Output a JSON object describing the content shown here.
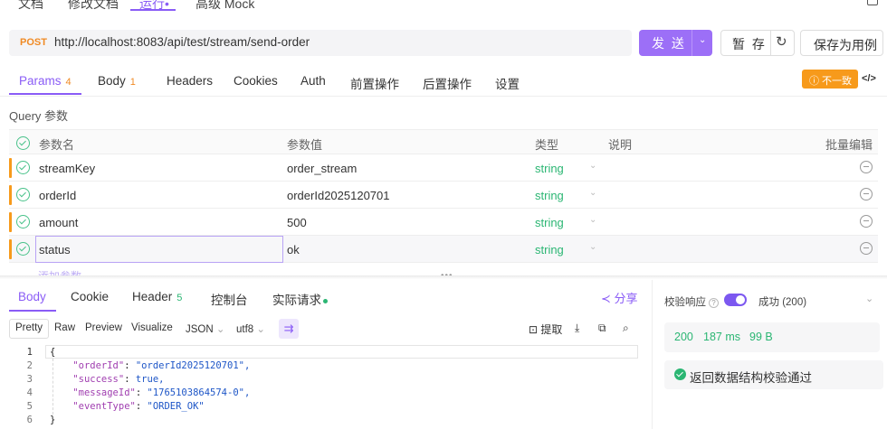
{
  "top_tabs": [
    {
      "label": "文档"
    },
    {
      "label": "修改文档"
    },
    {
      "label": "运行•"
    },
    {
      "label": "高级 Mock"
    }
  ],
  "request": {
    "method": "POST",
    "url": "http://localhost:8083/api/test/stream/send-order",
    "send_label": "发 送",
    "save_label": "暂 存",
    "save_case_label": "保存为用例"
  },
  "req_tabs": [
    {
      "label": "Params",
      "count": "4"
    },
    {
      "label": "Body",
      "count": "1"
    },
    {
      "label": "Headers"
    },
    {
      "label": "Cookies"
    },
    {
      "label": "Auth"
    },
    {
      "label": "前置操作"
    },
    {
      "label": "后置操作"
    },
    {
      "label": "设置"
    }
  ],
  "mismatch_badge": "ⓘ 不一致",
  "code_toggle": "</>",
  "query_label": "Query 参数",
  "table": {
    "headers": {
      "name": "参数名",
      "value": "参数值",
      "type": "类型",
      "desc": "说明",
      "bulk": "批量编辑"
    },
    "rows": [
      {
        "name": "streamKey",
        "value": "order_stream",
        "type": "string"
      },
      {
        "name": "orderId",
        "value": "orderId2025120701",
        "type": "string"
      },
      {
        "name": "amount",
        "value": "500",
        "type": "string"
      },
      {
        "name": "status",
        "value": "ok",
        "type": "string"
      }
    ],
    "add_param": "添加参数"
  },
  "res_tabs": [
    {
      "label": "Body"
    },
    {
      "label": "Cookie"
    },
    {
      "label": "Header",
      "count": "5"
    },
    {
      "label": "控制台"
    },
    {
      "label": "实际请求"
    }
  ],
  "share_label": "分享",
  "format_bar": {
    "modes": [
      "Pretty",
      "Raw",
      "Preview",
      "Visualize"
    ],
    "format": "JSON",
    "encoding": "utf8",
    "extract": "提取"
  },
  "code_lines": [
    {
      "n": "1",
      "text": "{"
    },
    {
      "n": "2",
      "key": "\"orderId\"",
      "val": "\"orderId2025120701\","
    },
    {
      "n": "3",
      "key": "\"success\"",
      "val": "true,"
    },
    {
      "n": "4",
      "key": "\"messageId\"",
      "val": "\"1765103864574-0\","
    },
    {
      "n": "5",
      "key": "\"eventType\"",
      "val": "\"ORDER_OK\""
    },
    {
      "n": "6",
      "text": "}"
    }
  ],
  "validation": {
    "label": "校验响应",
    "result": "成功 (200)",
    "status": "200",
    "time": "187 ms",
    "size": "99 B",
    "message": "返回数据结构校验通过"
  },
  "colors": {
    "accent": "#8a5cf6",
    "success": "#2bb673",
    "warning": "#f79a1b"
  }
}
